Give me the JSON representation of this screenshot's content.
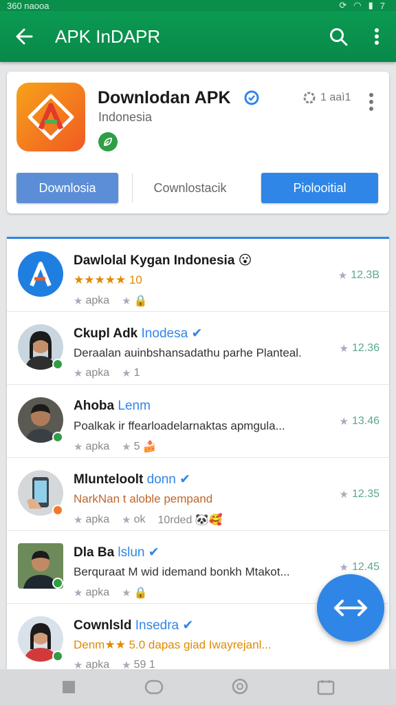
{
  "status_bar": {
    "left_text": "360 naooa",
    "right_text": "7"
  },
  "app_bar": {
    "title": "APK InDAPR"
  },
  "app_card": {
    "name": "Downlodan APK",
    "subtitle": "Indonesia",
    "rating_text": "1 aaì1",
    "buttons": [
      "Downlosia",
      "Cownlostacik",
      "Piolooitial"
    ]
  },
  "list": [
    {
      "title": "Dawlolal Kygan Indonesia",
      "title_hl": "",
      "emoji": "😮",
      "sub": "★★★★★ 10",
      "sub_color": "#e08a00",
      "meta": [
        "apka",
        "",
        ""
      ],
      "count": "12.3B",
      "dot_color": ""
    },
    {
      "title": "Ckupl Adk",
      "title_hl": "Inodesa",
      "emoji": "",
      "sub": "Deraalan auinbshansadathu parhe Planteal.",
      "sub_color": "#333333",
      "meta": [
        "apka",
        "1",
        ""
      ],
      "count": "12.36",
      "dot_color": "#2f9e44"
    },
    {
      "title": "Ahoba",
      "title_hl": "Lenm",
      "emoji": "",
      "sub": "Poalkak ir ffearloadelarnaktas apmgula...",
      "sub_color": "#333333",
      "meta": [
        "apka",
        "5",
        "🍰"
      ],
      "count": "13.46",
      "dot_color": "#2f9e44"
    },
    {
      "title": "Mlunteloolt",
      "title_hl": "donn",
      "emoji": "",
      "sub": "NarkNan t aloble pempand",
      "sub_color": "#c0652a",
      "meta": [
        "apka",
        "ok",
        "10rded 🐼🥰"
      ],
      "count": "12.35",
      "dot_color": "#f07a2a"
    },
    {
      "title": "Dla Ba",
      "title_hl": "lslun",
      "emoji": "",
      "sub": "Berquraat M wid idemand bonkh Mtakot...",
      "sub_color": "#333333",
      "meta": [
        "apka",
        "",
        ""
      ],
      "count": "12.45",
      "dot_color": "#2f9e44"
    },
    {
      "title": "Cownlsld",
      "title_hl": "Insedra",
      "emoji": "",
      "sub": "Denm★★ 5.0 dapas giad Iwayrejanl...",
      "sub_color": "#e08a00",
      "meta": [
        "apka",
        "59 1",
        ""
      ],
      "count": "",
      "dot_color": "#2f9e44"
    }
  ]
}
